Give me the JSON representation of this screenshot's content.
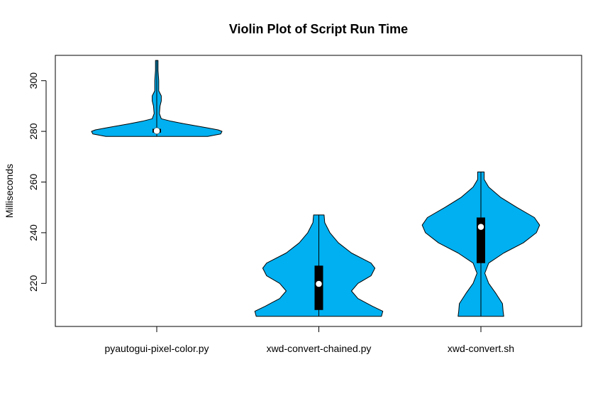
{
  "chart_data": {
    "type": "violin",
    "title": "Violin Plot of Script Run Time",
    "xlabel": "",
    "ylabel": "Milliseconds",
    "ylim": [
      203,
      310
    ],
    "yticks": [
      220,
      240,
      260,
      280,
      300
    ],
    "fill_color": "#00b0f0",
    "categories": [
      {
        "name": "pyautogui-pixel-color.py",
        "min": 278,
        "q1": 279.5,
        "median": 280.2,
        "q3": 281,
        "max": 308,
        "density": [
          [
            278,
            0.78
          ],
          [
            279,
            0.98
          ],
          [
            280,
            1.0
          ],
          [
            280.6,
            0.94
          ],
          [
            281.5,
            0.75
          ],
          [
            283,
            0.42
          ],
          [
            284,
            0.22
          ],
          [
            285,
            0.07
          ],
          [
            287,
            0.04
          ],
          [
            290,
            0.05
          ],
          [
            292,
            0.07
          ],
          [
            294,
            0.07
          ],
          [
            296,
            0.03
          ],
          [
            300,
            0.03
          ],
          [
            304,
            0.02
          ],
          [
            308,
            0.02
          ]
        ]
      },
      {
        "name": "xwd-convert-chained.py",
        "min": 207,
        "q1": 209.5,
        "median": 219.8,
        "q3": 227,
        "max": 247,
        "density": [
          [
            207,
            0.96
          ],
          [
            209,
            0.98
          ],
          [
            211,
            0.82
          ],
          [
            214,
            0.6
          ],
          [
            217,
            0.5
          ],
          [
            220,
            0.6
          ],
          [
            223,
            0.8
          ],
          [
            226,
            0.86
          ],
          [
            228,
            0.8
          ],
          [
            232,
            0.5
          ],
          [
            236,
            0.3
          ],
          [
            240,
            0.17
          ],
          [
            244,
            0.09
          ],
          [
            247,
            0.08
          ]
        ]
      },
      {
        "name": "xwd-convert.sh",
        "min": 207,
        "q1": 228,
        "median": 242.3,
        "q3": 246,
        "max": 264,
        "density": [
          [
            207,
            0.35
          ],
          [
            209,
            0.34
          ],
          [
            212,
            0.33
          ],
          [
            216,
            0.23
          ],
          [
            220,
            0.12
          ],
          [
            224,
            0.06
          ],
          [
            228,
            0.12
          ],
          [
            232,
            0.35
          ],
          [
            236,
            0.65
          ],
          [
            240,
            0.85
          ],
          [
            243,
            0.9
          ],
          [
            246,
            0.82
          ],
          [
            250,
            0.55
          ],
          [
            254,
            0.3
          ],
          [
            258,
            0.12
          ],
          [
            261,
            0.05
          ],
          [
            264,
            0.05
          ]
        ]
      }
    ]
  }
}
